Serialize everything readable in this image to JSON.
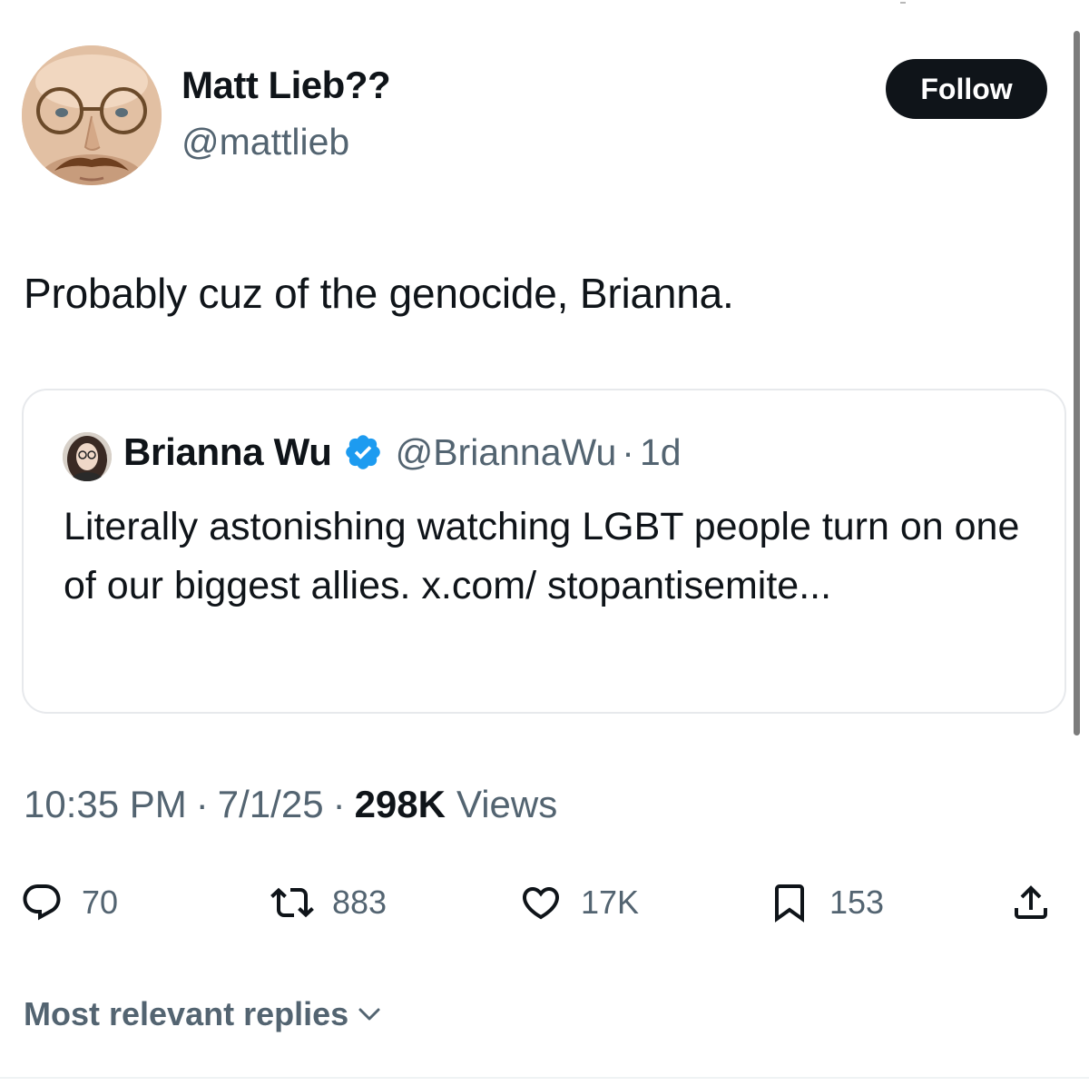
{
  "tweet": {
    "author": {
      "name": "Matt Lieb??",
      "handle": "@mattlieb"
    },
    "follow_label": "Follow",
    "text": "Probably cuz of the genocide, Brianna.",
    "quoted": {
      "name": "Brianna Wu",
      "verified": true,
      "handle": "@BriannaWu",
      "separator": "·",
      "time": "1d",
      "text": "Literally astonishing watching LGBT people turn on one of our biggest allies. x.com/ stopantisemite..."
    },
    "meta": {
      "time": "10:35 PM",
      "separator": "·",
      "date": "7/1/25",
      "views_count": "298K",
      "views_label": "Views"
    },
    "actions": {
      "replies": "70",
      "reposts": "883",
      "likes": "17K",
      "bookmarks": "153"
    },
    "replies_sort_label": "Most relevant replies"
  },
  "colors": {
    "text_primary": "#0f1419",
    "text_secondary": "#536471",
    "verified_blue": "#1d9bf0",
    "follow_bg": "#0f1419",
    "border": "#e7e9ec"
  },
  "icons": {
    "reply": "reply-icon",
    "repost": "repost-icon",
    "like": "heart-icon",
    "bookmark": "bookmark-icon",
    "share": "share-icon",
    "verified": "verified-badge-icon",
    "chevron": "chevron-down-icon"
  }
}
